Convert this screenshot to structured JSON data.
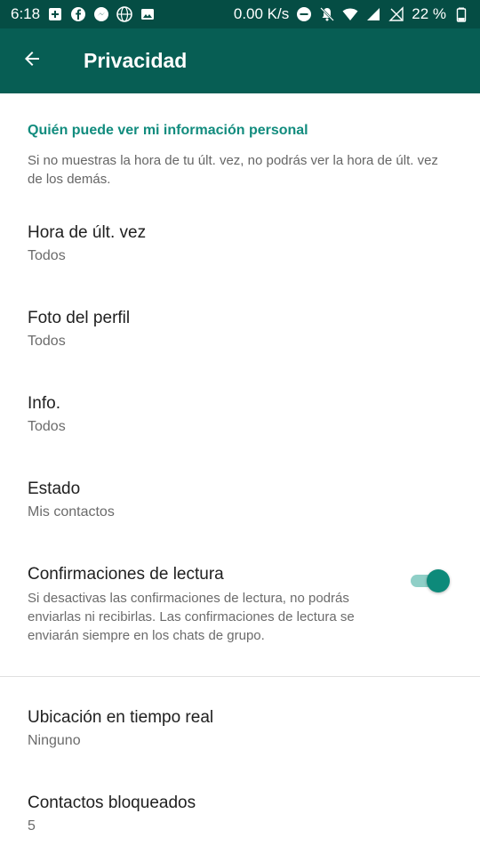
{
  "status_bar": {
    "time": "6:18",
    "network_speed": "0.00 K/s",
    "battery": "22 %",
    "left_icons": [
      "add-box-icon",
      "facebook-icon",
      "messenger-icon",
      "globe-icon",
      "image-icon"
    ],
    "right_icons": [
      "do-not-disturb-icon",
      "notifications-off-icon",
      "wifi-icon",
      "signal-icon",
      "no-signal-icon",
      "battery-icon"
    ]
  },
  "app_bar": {
    "title": "Privacidad",
    "back_icon": "arrow-back-icon"
  },
  "section": {
    "header": "Quién puede ver mi información personal",
    "description": "Si no muestras la hora de tu últ. vez, no podrás ver la hora de últ. vez de los demás."
  },
  "items": [
    {
      "title": "Hora de últ. vez",
      "value": "Todos"
    },
    {
      "title": "Foto del perfil",
      "value": "Todos"
    },
    {
      "title": "Info.",
      "value": "Todos"
    },
    {
      "title": "Estado",
      "value": "Mis contactos"
    }
  ],
  "read_receipts": {
    "title": "Confirmaciones de lectura",
    "description": "Si desactivas las confirmaciones de lectura, no podrás enviarlas ni recibirlas. Las confirmaciones de lectura se enviarán siempre en los chats de grupo.",
    "enabled": true
  },
  "extra_items": [
    {
      "title": "Ubicación en tiempo real",
      "value": "Ninguno"
    },
    {
      "title": "Contactos bloqueados",
      "value": "5"
    }
  ],
  "colors": {
    "status_bar": "#054d44",
    "app_bar": "#075e54",
    "accent": "#128c7e",
    "toggle_thumb": "#0d8a7a",
    "toggle_track": "#8fcfc7"
  }
}
